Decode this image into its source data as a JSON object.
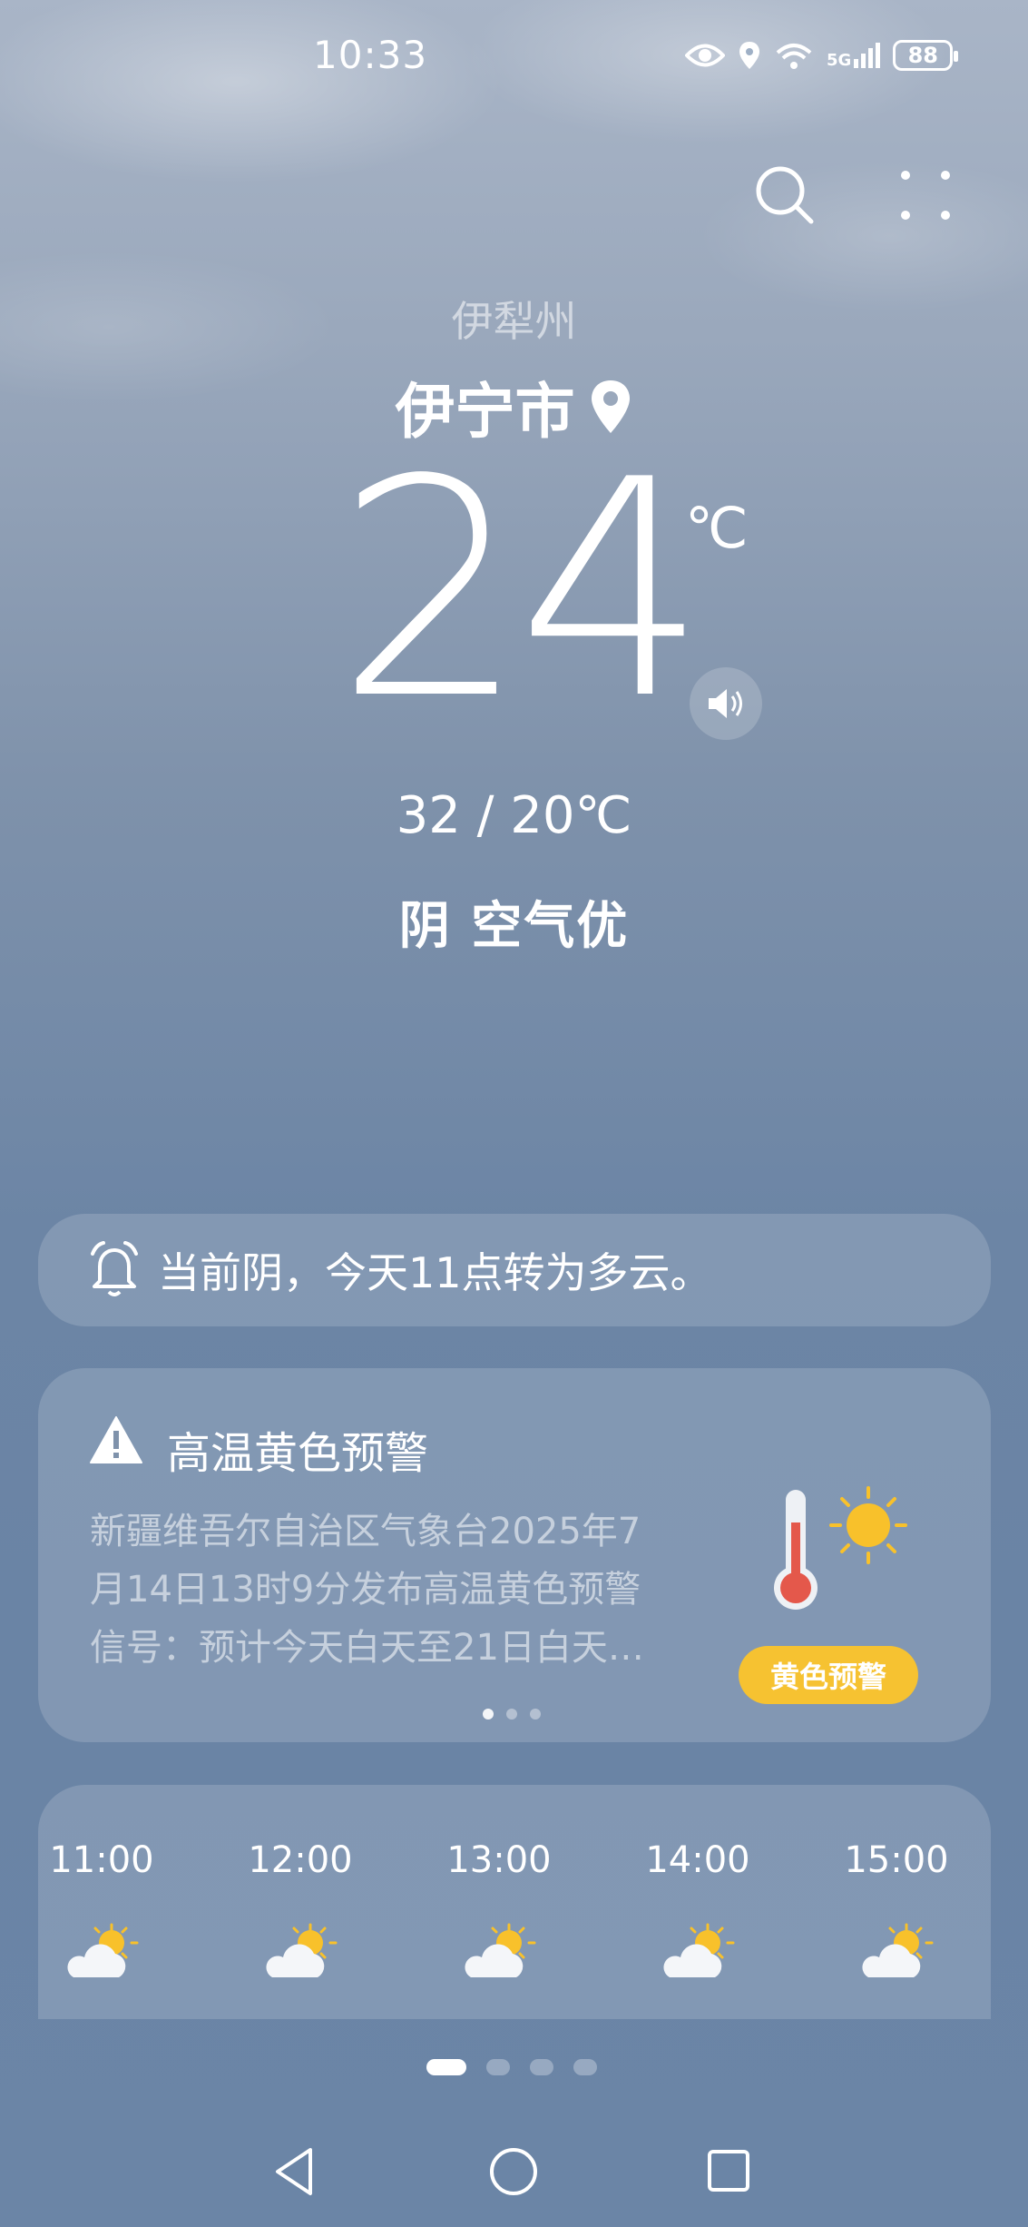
{
  "status_bar": {
    "time": "10:33",
    "battery": "88",
    "network": "5G"
  },
  "location": {
    "prefecture": "伊犁州",
    "city": "伊宁市"
  },
  "current": {
    "temperature": "24",
    "unit": "℃",
    "range": "32 / 20℃",
    "condition": "阴  空气优"
  },
  "notice": {
    "text": "当前阴，今天11点转为多云。"
  },
  "alert": {
    "title": "高温黄色预警",
    "lines": [
      "新疆维吾尔自治区气象台2025年7",
      "月14日13时9分发布高温黄色预警",
      "信号：预计今天白天至21日白天…"
    ],
    "badge": "黄色预警",
    "page_dots": 3,
    "active_dot": 1
  },
  "hourly": [
    {
      "time": "11:00",
      "icon": "partly-cloudy-icon"
    },
    {
      "time": "12:00",
      "icon": "partly-cloudy-icon"
    },
    {
      "time": "13:00",
      "icon": "partly-cloudy-icon"
    },
    {
      "time": "14:00",
      "icon": "partly-cloudy-icon"
    },
    {
      "time": "15:00",
      "icon": "partly-cloudy-icon"
    }
  ],
  "pages": {
    "count": 4,
    "active": 1
  },
  "colors": {
    "badge": "#f6c231",
    "sun": "#f8c12b",
    "thermometer": "#e4584b"
  }
}
